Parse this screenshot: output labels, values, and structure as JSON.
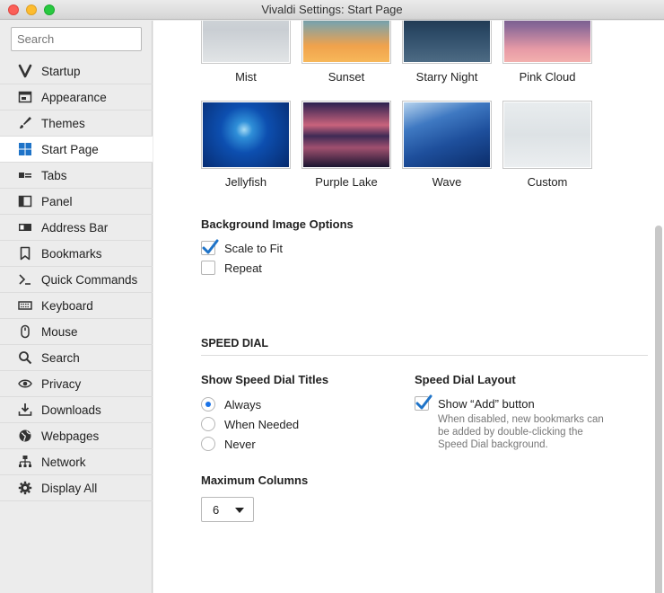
{
  "window": {
    "title": "Vivaldi Settings: Start Page"
  },
  "search": {
    "placeholder": "Search"
  },
  "sidebar": {
    "items": [
      {
        "label": "Startup",
        "icon": "vivaldi-logo-icon"
      },
      {
        "label": "Appearance",
        "icon": "window-icon"
      },
      {
        "label": "Themes",
        "icon": "brush-icon"
      },
      {
        "label": "Start Page",
        "icon": "grid-icon",
        "active": true
      },
      {
        "label": "Tabs",
        "icon": "tabs-icon"
      },
      {
        "label": "Panel",
        "icon": "panel-icon"
      },
      {
        "label": "Address Bar",
        "icon": "address-bar-icon"
      },
      {
        "label": "Bookmarks",
        "icon": "bookmark-icon"
      },
      {
        "label": "Quick Commands",
        "icon": "terminal-icon"
      },
      {
        "label": "Keyboard",
        "icon": "keyboard-icon"
      },
      {
        "label": "Mouse",
        "icon": "mouse-icon"
      },
      {
        "label": "Search",
        "icon": "magnifier-icon"
      },
      {
        "label": "Privacy",
        "icon": "eye-icon"
      },
      {
        "label": "Downloads",
        "icon": "download-icon"
      },
      {
        "label": "Webpages",
        "icon": "globe-icon"
      },
      {
        "label": "Network",
        "icon": "network-icon"
      },
      {
        "label": "Display All",
        "icon": "gear-icon"
      }
    ]
  },
  "backgrounds": {
    "row1": [
      {
        "label": "Mist"
      },
      {
        "label": "Sunset"
      },
      {
        "label": "Starry Night"
      },
      {
        "label": "Pink Cloud"
      }
    ],
    "row2": [
      {
        "label": "Jellyfish"
      },
      {
        "label": "Purple Lake"
      },
      {
        "label": "Wave"
      },
      {
        "label": "Custom"
      }
    ]
  },
  "bg_options": {
    "title": "Background Image Options",
    "scale_to_fit": {
      "label": "Scale to Fit",
      "checked": true
    },
    "repeat": {
      "label": "Repeat",
      "checked": false
    }
  },
  "speed_dial": {
    "section_title": "SPEED DIAL",
    "titles": {
      "heading": "Show Speed Dial Titles",
      "options": [
        {
          "label": "Always",
          "checked": true
        },
        {
          "label": "When Needed",
          "checked": false
        },
        {
          "label": "Never",
          "checked": false
        }
      ]
    },
    "layout": {
      "heading": "Speed Dial Layout",
      "show_add": {
        "label": "Show “Add” button",
        "checked": true
      },
      "help": "When disabled, new bookmarks can be added by double-clicking the Speed Dial background."
    },
    "max_columns": {
      "heading": "Maximum Columns",
      "value": "6"
    }
  },
  "colors": {
    "accent": "#1a73e8",
    "active_item": "#ffffff"
  }
}
